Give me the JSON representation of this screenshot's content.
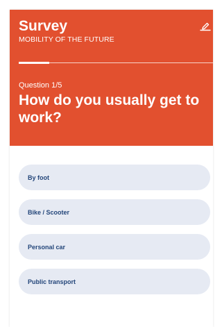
{
  "header": {
    "title": "Survey",
    "subtitle": "MOBILITY OF THE FUTURE",
    "edit_icon": "edit-pencil-icon"
  },
  "question": {
    "number_label": "Question 1/5",
    "text": "How do you usually get to work?"
  },
  "answers": [
    {
      "label": "By foot"
    },
    {
      "label": "Bike / Scooter"
    },
    {
      "label": "Personal car"
    },
    {
      "label": "Public transport"
    }
  ],
  "colors": {
    "header_background": "#e2502f",
    "answer_background": "#e6eaf3",
    "answer_text": "#24467a"
  }
}
